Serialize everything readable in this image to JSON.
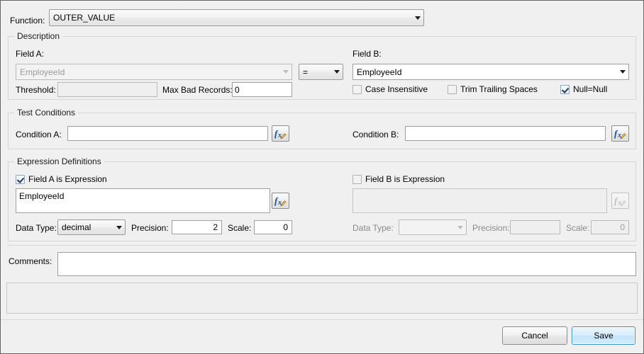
{
  "dialog": {
    "function_label": "Function:",
    "function_value": "OUTER_VALUE"
  },
  "description": {
    "title": "Description",
    "field_a_label": "Field A:",
    "field_a_value": "EmployeeId",
    "operator_value": "=",
    "field_b_label": "Field B:",
    "field_b_value": "EmployeeId",
    "threshold_label": "Threshold:",
    "threshold_value": "",
    "max_bad_records_label": "Max Bad Records:",
    "max_bad_records_value": "0",
    "case_insensitive_label": "Case Insensitive",
    "trim_trailing_spaces_label": "Trim Trailing Spaces",
    "null_equals_null_label": "Null=Null"
  },
  "test_conditions": {
    "title": "Test Conditions",
    "condition_a_label": "Condition A:",
    "condition_a_value": "",
    "condition_b_label": "Condition B:",
    "condition_b_value": "",
    "fx_icon": "function-editor-icon"
  },
  "expression_definitions": {
    "title": "Expression Definitions",
    "field_a_is_expression_label": "Field A is Expression",
    "field_a_expression_value": "EmployeeId",
    "field_a_data_type_label": "Data Type:",
    "field_a_data_type_value": "decimal",
    "field_a_precision_label": "Precision:",
    "field_a_precision_value": "2",
    "field_a_scale_label": "Scale:",
    "field_a_scale_value": "0",
    "field_b_is_expression_label": "Field B is Expression",
    "field_b_expression_value": "",
    "field_b_data_type_label": "Data Type:",
    "field_b_data_type_value": "",
    "field_b_precision_label": "Precision:",
    "field_b_precision_value": "",
    "field_b_scale_label": "Scale:",
    "field_b_scale_value": "0"
  },
  "comments": {
    "label": "Comments:",
    "value": ""
  },
  "footer": {
    "cancel_label": "Cancel",
    "save_label": "Save"
  },
  "colors": {
    "window_background": "#f0f0f0",
    "input_background": "#ffffff",
    "disabled_background": "#efefef",
    "border": "#a0a0a0",
    "group_border": "#d5d5d5",
    "default_button_accent": "#3c93d4",
    "checkbox_check": "#2a3a55"
  }
}
